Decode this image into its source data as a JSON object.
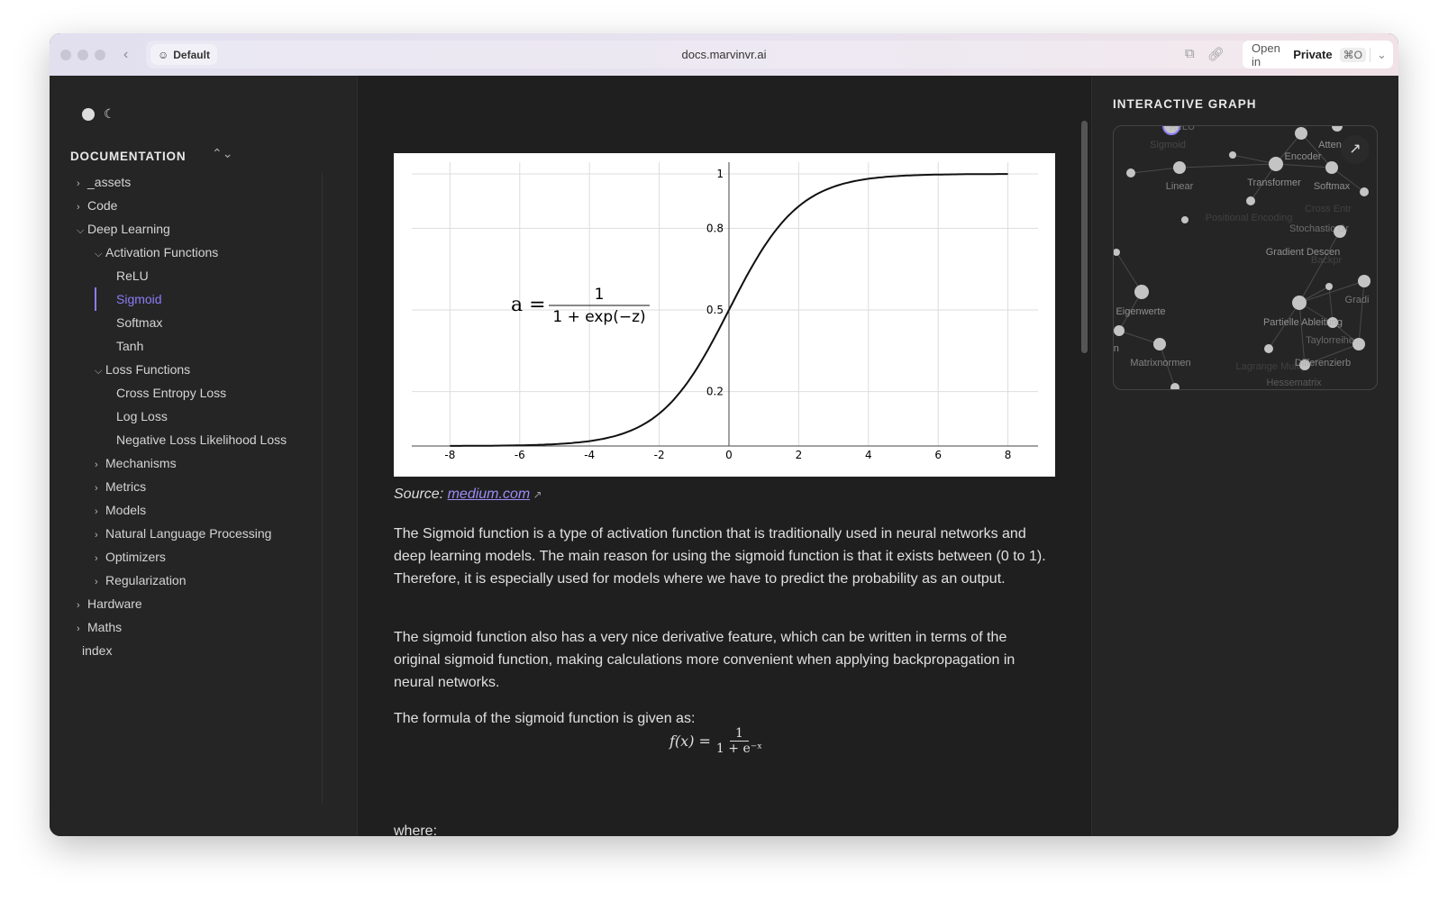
{
  "browser": {
    "profile": "Default",
    "url": "docs.marvinvr.ai",
    "open_in": "Open in",
    "private": "Private",
    "shortcut": "⌘O"
  },
  "sidebar": {
    "heading": "DOCUMENTATION",
    "items": [
      {
        "label": "_assets",
        "depth": 0,
        "chevron": "right"
      },
      {
        "label": "Code",
        "depth": 0,
        "chevron": "right"
      },
      {
        "label": "Deep Learning",
        "depth": 0,
        "chevron": "down"
      },
      {
        "label": "Activation Functions",
        "depth": 1,
        "chevron": "down"
      },
      {
        "label": "ReLU",
        "depth": 2,
        "chevron": ""
      },
      {
        "label": "Sigmoid",
        "depth": 2,
        "chevron": "",
        "selected": true
      },
      {
        "label": "Softmax",
        "depth": 2,
        "chevron": ""
      },
      {
        "label": "Tanh",
        "depth": 2,
        "chevron": ""
      },
      {
        "label": "Loss Functions",
        "depth": 1,
        "chevron": "down"
      },
      {
        "label": "Cross Entropy Loss",
        "depth": 2,
        "chevron": ""
      },
      {
        "label": "Log Loss",
        "depth": 2,
        "chevron": ""
      },
      {
        "label": "Negative Loss Likelihood Loss",
        "depth": 2,
        "chevron": ""
      },
      {
        "label": "Mechanisms",
        "depth": 1,
        "chevron": "right"
      },
      {
        "label": "Metrics",
        "depth": 1,
        "chevron": "right"
      },
      {
        "label": "Models",
        "depth": 1,
        "chevron": "right"
      },
      {
        "label": "Natural Language Processing",
        "depth": 1,
        "chevron": "right"
      },
      {
        "label": "Optimizers",
        "depth": 1,
        "chevron": "right"
      },
      {
        "label": "Regularization",
        "depth": 1,
        "chevron": "right"
      },
      {
        "label": "Hardware",
        "depth": 0,
        "chevron": "right"
      },
      {
        "label": "Maths",
        "depth": 0,
        "chevron": "right"
      },
      {
        "label": "index",
        "depth": 0,
        "chevron": ""
      }
    ]
  },
  "main": {
    "figure": {
      "formula_lhs": "a =",
      "formula_num": "1",
      "formula_den": "1 + exp(−z)",
      "x_ticks": [
        -8,
        -6,
        -4,
        -2,
        0,
        2,
        4,
        6,
        8
      ],
      "y_ticks": [
        0.2,
        0.5,
        0.8,
        1
      ],
      "xlim": [
        -8,
        8
      ],
      "ylim": [
        0,
        1
      ],
      "function": "sigmoid"
    },
    "source_label": "Source:",
    "source_link": "medium.com",
    "paragraphs": [
      "The Sigmoid function is a type of activation function that is traditionally used in neural networks and deep learning models. The main reason for using the sigmoid function is that it exists between (0 to 1). Therefore, it is especially used for models where we have to predict the probability as an output.",
      "The sigmoid function also has a very nice derivative feature, which can be written in terms of the original sigmoid function, making calculations more convenient when applying backpropagation in neural networks.",
      "The formula of the sigmoid function is given as:"
    ],
    "formula": {
      "lhs": "f(x) =",
      "num": "1",
      "den": "1 + e⁻ˣ"
    },
    "where": "where:"
  },
  "graph": {
    "heading": "INTERACTIVE GRAPH",
    "accent": "#8b7cf6",
    "labels": [
      "ReLU",
      "Sigmoid",
      "Linear",
      "Transformer",
      "Encoder",
      "Atten",
      "Softmax",
      "Positional Encoding",
      "Cross Entr",
      "Stochastic Gr",
      "Gradient Descen",
      "Backpr",
      "Gradi",
      "Eigenwerte",
      "Partielle Ableitung",
      "Taylorreihe",
      "rizen",
      "Matrixnormen",
      "Lagrange Multip",
      "Differenzierb",
      "Hessematrix"
    ]
  }
}
